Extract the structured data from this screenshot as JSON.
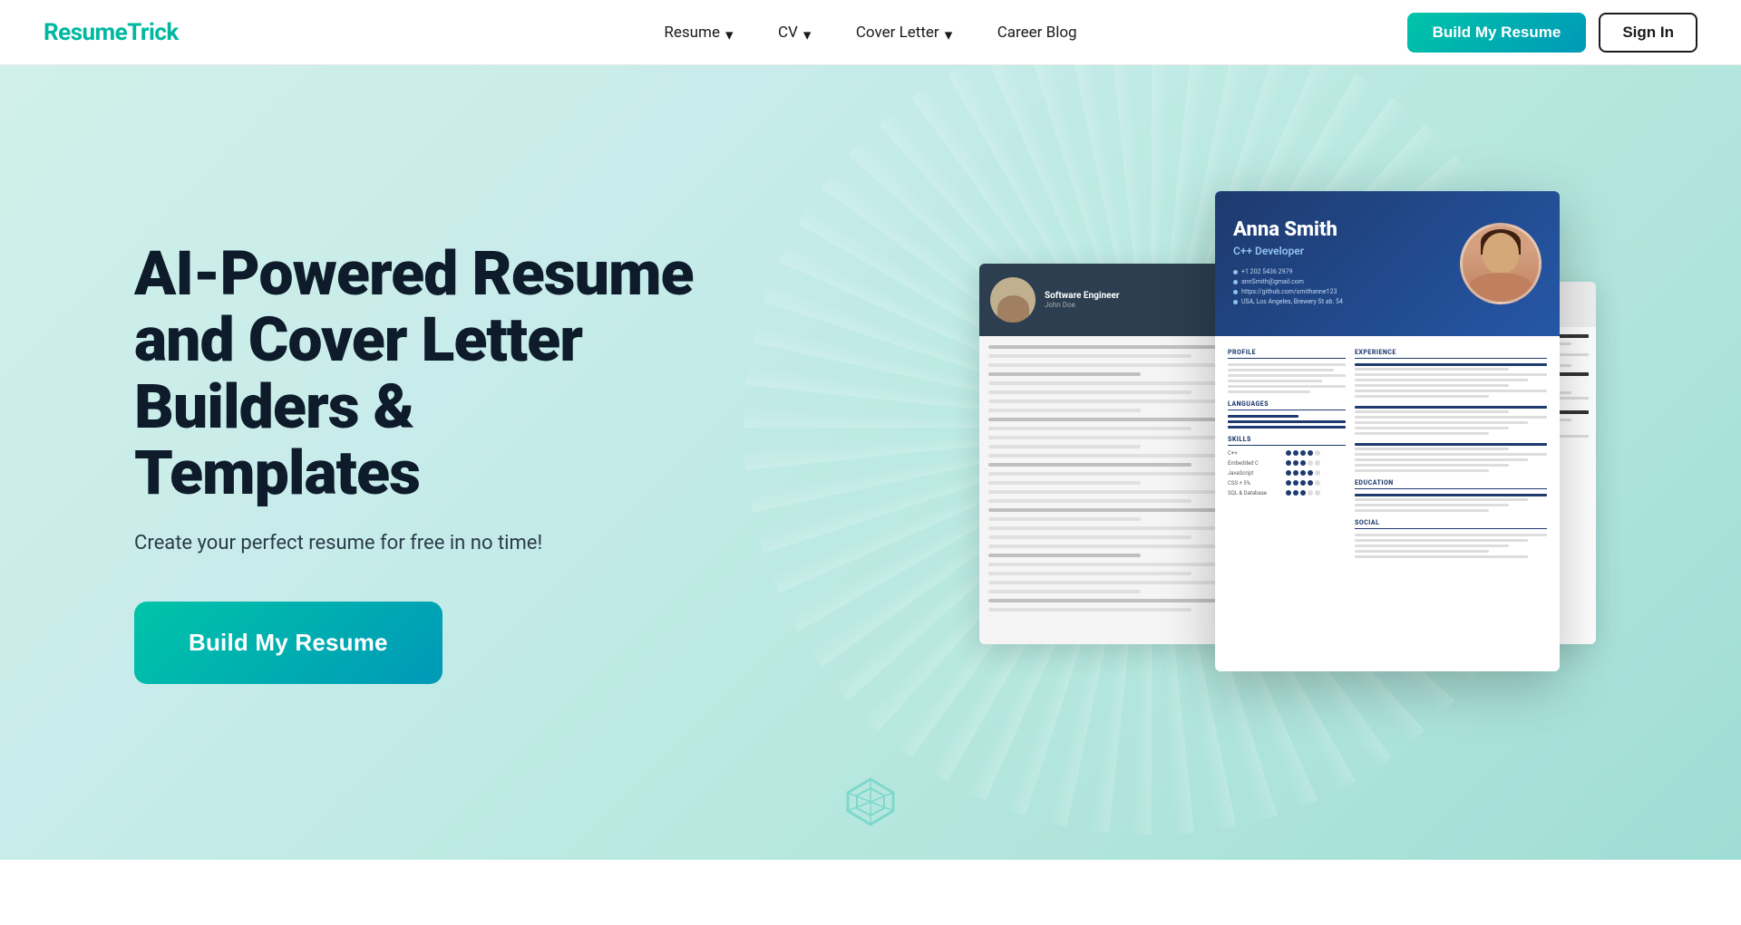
{
  "header": {
    "logo_text": "Resume",
    "logo_accent": "Trick",
    "nav": [
      {
        "id": "resume",
        "label": "Resume",
        "has_dropdown": true
      },
      {
        "id": "cv",
        "label": "CV",
        "has_dropdown": true
      },
      {
        "id": "cover-letter",
        "label": "Cover Letter",
        "has_dropdown": true
      },
      {
        "id": "career-blog",
        "label": "Career Blog",
        "has_dropdown": false
      }
    ],
    "cta_button": "Build My Resume",
    "sign_in_button": "Sign In"
  },
  "hero": {
    "title": "AI-Powered Resume and Cover Letter Builders & Templates",
    "subtitle": "Create your perfect resume for free in no time!",
    "cta_button": "Build My Resume"
  },
  "resume_preview": {
    "front": {
      "name": "Anna Smith",
      "role": "C++ Developer",
      "contact1": "+1 202 5436 2979",
      "contact2": "annSmith@gmail.com",
      "contact3": "https://github.com/smithanne123",
      "contact4": "USA, Los Angeles, Brewery St ab. 54"
    }
  },
  "icons": {
    "chevron_down": "▾"
  }
}
